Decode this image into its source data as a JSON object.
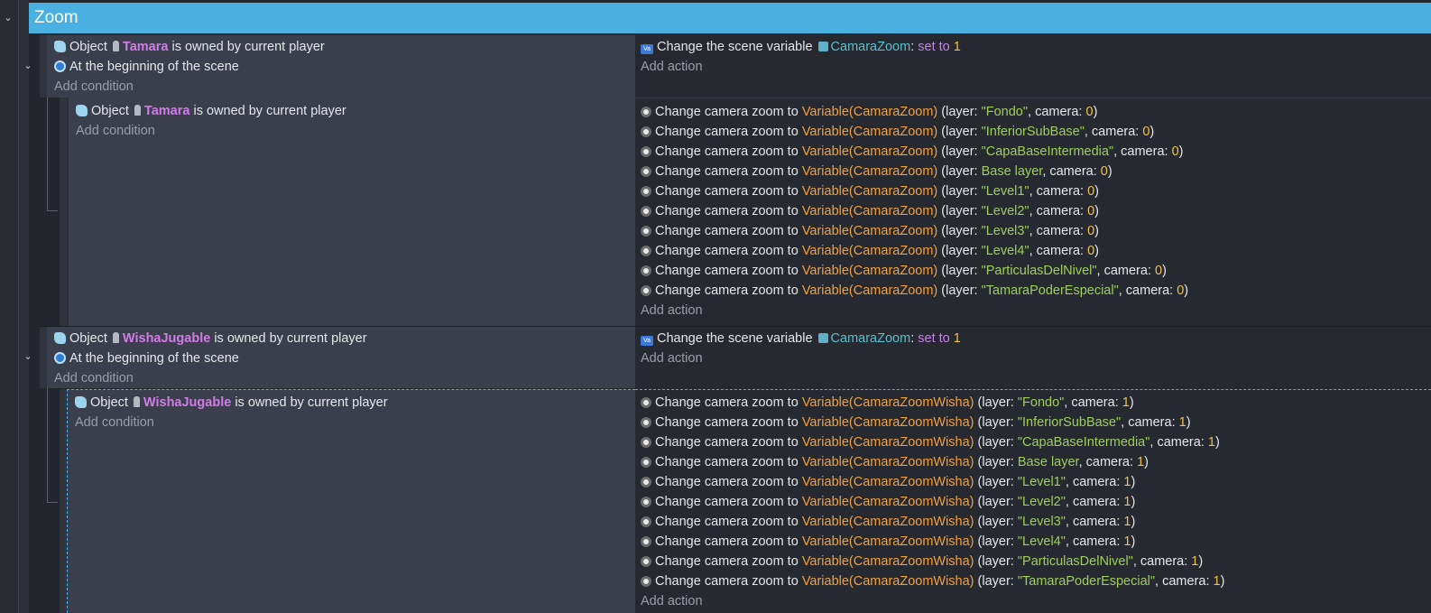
{
  "group": {
    "title": "Zoom"
  },
  "texts": {
    "object": "Object",
    "owned_suffix": "is owned by current player",
    "begin_scene": "At the beginning of the scene",
    "add_condition": "Add condition",
    "add_action": "Add action",
    "change_scene_var": "Change the scene variable",
    "change_zoom_to": "Change camera zoom to",
    "layer_open": "(layer:",
    "camera_label": ", camera:",
    "close_paren": ")",
    "colon": ":",
    "set_to": "set to"
  },
  "events": [
    {
      "object": "Tamara",
      "scene_variable": "CamaraZoom",
      "set_value": "1",
      "sub_object": "Tamara",
      "zoom_expr": "Variable(CamaraZoom)",
      "camera": "0",
      "layers": [
        "\"Fondo\"",
        "\"InferiorSubBase\"",
        "\"CapaBaseIntermedia\"",
        "Base layer",
        "\"Level1\"",
        "\"Level2\"",
        "\"Level3\"",
        "\"Level4\"",
        "\"ParticulasDelNivel\"",
        "\"TamaraPoderEspecial\""
      ]
    },
    {
      "object": "WishaJugable",
      "scene_variable": "CamaraZoom",
      "set_value": "1",
      "sub_object": "WishaJugable",
      "zoom_expr": "Variable(CamaraZoomWisha)",
      "camera": "1",
      "layers": [
        "\"Fondo\"",
        "\"InferiorSubBase\"",
        "\"CapaBaseIntermedia\"",
        "Base layer",
        "\"Level1\"",
        "\"Level2\"",
        "\"Level3\"",
        "\"Level4\"",
        "\"ParticulasDelNivel\"",
        "\"TamaraPoderEspecial\""
      ]
    }
  ],
  "colors": {
    "group_header": "#4ab0e2",
    "condition_bg": "#3b3e4c",
    "action_bg": "#272930",
    "object_name": "#d27ce6",
    "function": "#f1a13e",
    "string": "#9ccf5b",
    "number": "#f0c24c"
  }
}
